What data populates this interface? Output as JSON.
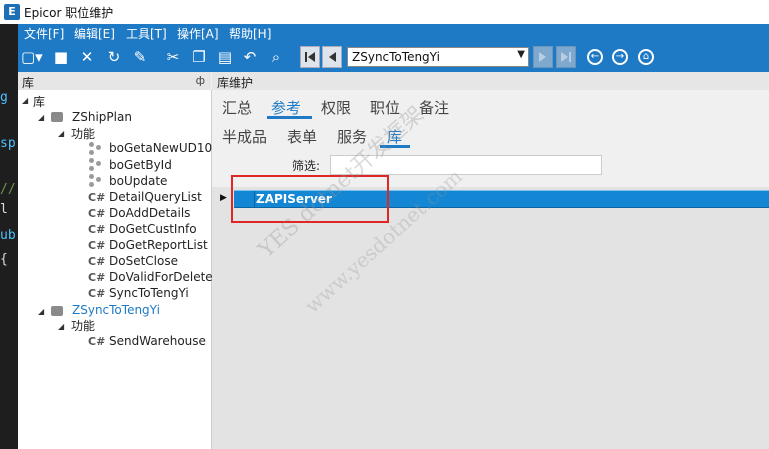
{
  "window": {
    "app_icon": "E",
    "title": "Epicor 职位维护"
  },
  "menu": [
    "文件[F]",
    "编辑[E]",
    "工具[T]",
    "操作[A]",
    "帮助[H]"
  ],
  "toolbar": {
    "icons": [
      "new-icon",
      "save-icon",
      "delete-icon",
      "refresh-icon",
      "clear-icon",
      "cut-icon",
      "copy-icon",
      "paste-icon",
      "undo-icon",
      "binoculars-icon"
    ],
    "combo_value": "ZSyncToTengYi"
  },
  "left_panel": {
    "title": "库",
    "pin": "ф"
  },
  "right_panel": {
    "title": "库维护"
  },
  "tree": {
    "root": "库",
    "node1": {
      "label": "ZShipPlan",
      "func_label": "功能",
      "items": [
        {
          "type": "bo",
          "label": "boGetaNewUD10"
        },
        {
          "type": "bo",
          "label": "boGetById"
        },
        {
          "type": "bo",
          "label": "boUpdate"
        },
        {
          "type": "cs",
          "label": "DetailQueryList"
        },
        {
          "type": "cs",
          "label": "DoAddDetails"
        },
        {
          "type": "cs",
          "label": "DoGetCustInfo"
        },
        {
          "type": "cs",
          "label": "DoGetReportList"
        },
        {
          "type": "cs",
          "label": "DoSetClose"
        },
        {
          "type": "cs",
          "label": "DoValidForDelete"
        },
        {
          "type": "cs",
          "label": "SyncToTengYi"
        }
      ]
    },
    "node2": {
      "label": "ZSyncToTengYi",
      "func_label": "功能",
      "items": [
        {
          "type": "cs",
          "label": "SendWarehouse"
        }
      ]
    },
    "cs_glyph": "C#"
  },
  "tabs_row1": [
    "汇总",
    "参考",
    "权限",
    "职位",
    "备注"
  ],
  "tabs_row2": [
    "半成品",
    "表单",
    "服务",
    "库"
  ],
  "filter": {
    "label": "筛选:",
    "value": ""
  },
  "grid": {
    "rows": [
      {
        "name": "ZAPIServer"
      }
    ]
  },
  "watermark": {
    "line1": "YES dotnet开发框架",
    "line2": "www.yesdotnet.com"
  },
  "colors": {
    "accent": "#1f7ac6",
    "selection": "#1487d4",
    "highlight_box": "#e12626"
  }
}
